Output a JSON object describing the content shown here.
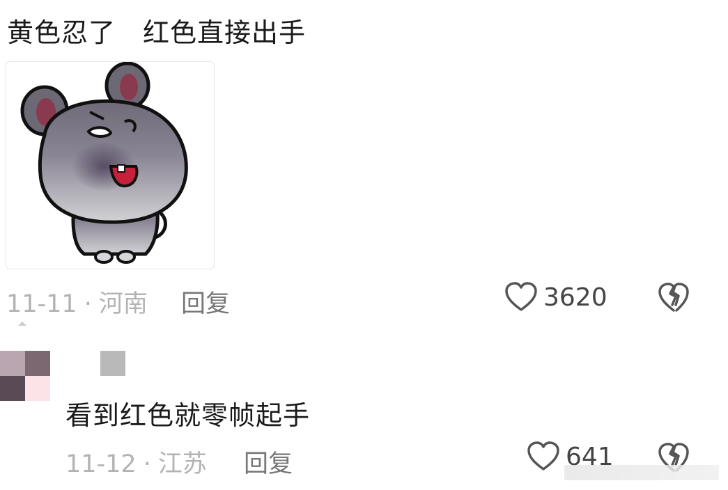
{
  "comments": [
    {
      "text": "黄色忍了　红色直接出手",
      "sticker": "gray-mouse-shouting-sticker",
      "date": "11-11",
      "location": "河南",
      "reply_label": "回复",
      "like_count": "3620"
    },
    {
      "text": "看到红色就零帧起手",
      "date": "11-12",
      "location": "江苏",
      "reply_label": "回复",
      "like_count": "641"
    }
  ],
  "separator": "·",
  "icons": {
    "like": "heart-outline-icon",
    "dislike": "broken-heart-icon"
  },
  "colors": {
    "meta_text": "#b3b3b3",
    "reply_text": "#777777",
    "count_text": "#444444",
    "icon_stroke": "#555555"
  }
}
